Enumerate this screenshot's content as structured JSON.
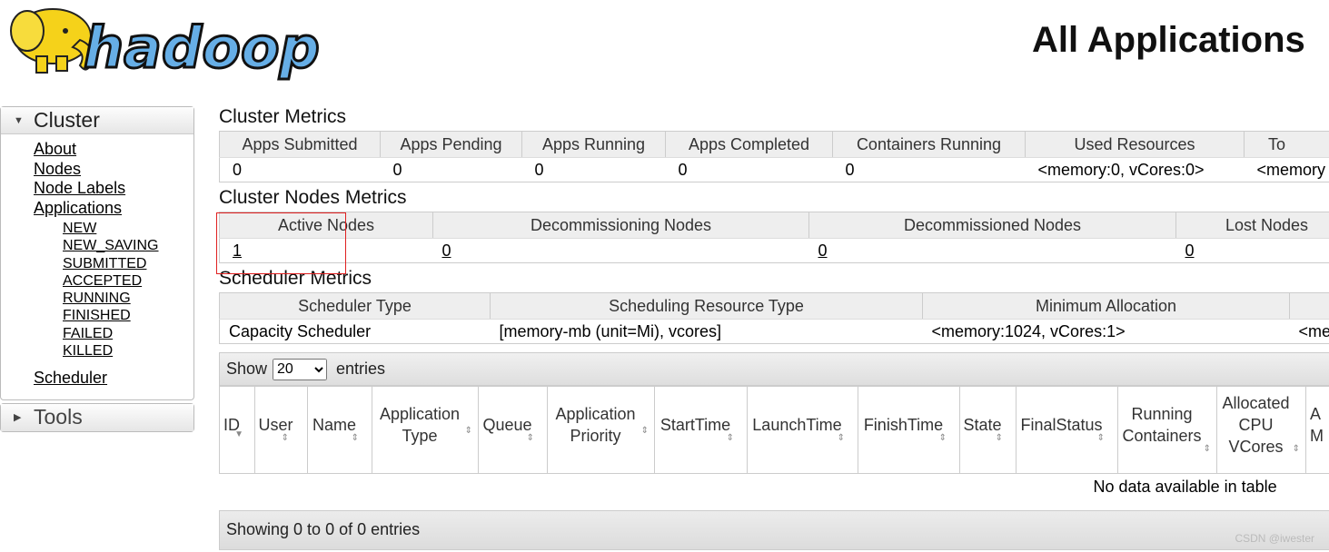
{
  "header": {
    "logo_text": "hadoop",
    "page_title": "All Applications"
  },
  "sidebar": {
    "cluster_label": "Cluster",
    "links": [
      "About",
      "Nodes",
      "Node Labels",
      "Applications"
    ],
    "app_states": [
      "NEW",
      "NEW_SAVING",
      "SUBMITTED",
      "ACCEPTED",
      "RUNNING",
      "FINISHED",
      "FAILED",
      "KILLED"
    ],
    "scheduler_label": "Scheduler",
    "tools_label": "Tools"
  },
  "cluster_metrics": {
    "title": "Cluster Metrics",
    "headers": [
      "Apps Submitted",
      "Apps Pending",
      "Apps Running",
      "Apps Completed",
      "Containers Running",
      "Used Resources",
      "To"
    ],
    "values": [
      "0",
      "0",
      "0",
      "0",
      "0",
      "<memory:0, vCores:0>",
      "<memory"
    ]
  },
  "nodes_metrics": {
    "title": "Cluster Nodes Metrics",
    "headers": [
      "Active Nodes",
      "Decommissioning Nodes",
      "Decommissioned Nodes",
      "Lost Nodes"
    ],
    "values": [
      "1",
      "0",
      "0",
      "0"
    ]
  },
  "scheduler_metrics": {
    "title": "Scheduler Metrics",
    "headers": [
      "Scheduler Type",
      "Scheduling Resource Type",
      "Minimum Allocation",
      ""
    ],
    "values": [
      "Capacity Scheduler",
      "[memory-mb (unit=Mi), vcores]",
      "<memory:1024, vCores:1>",
      "<me"
    ]
  },
  "apps_table": {
    "show_label": "Show",
    "entries_value": "20",
    "entries_label": "entries",
    "columns": [
      "ID",
      "User",
      "Name",
      "Application Type",
      "Queue",
      "Application Priority",
      "StartTime",
      "LaunchTime",
      "FinishTime",
      "State",
      "FinalStatus",
      "Running Containers",
      "Allocated CPU VCores",
      "A M"
    ],
    "empty_text": "No data available in table",
    "footer_text": "Showing 0 to 0 of 0 entries"
  },
  "watermark": "CSDN @iwester",
  "colors": {
    "highlight_box": "#e02020",
    "logo_yellow": "#f5d21a",
    "logo_blue": "#66aee6"
  }
}
